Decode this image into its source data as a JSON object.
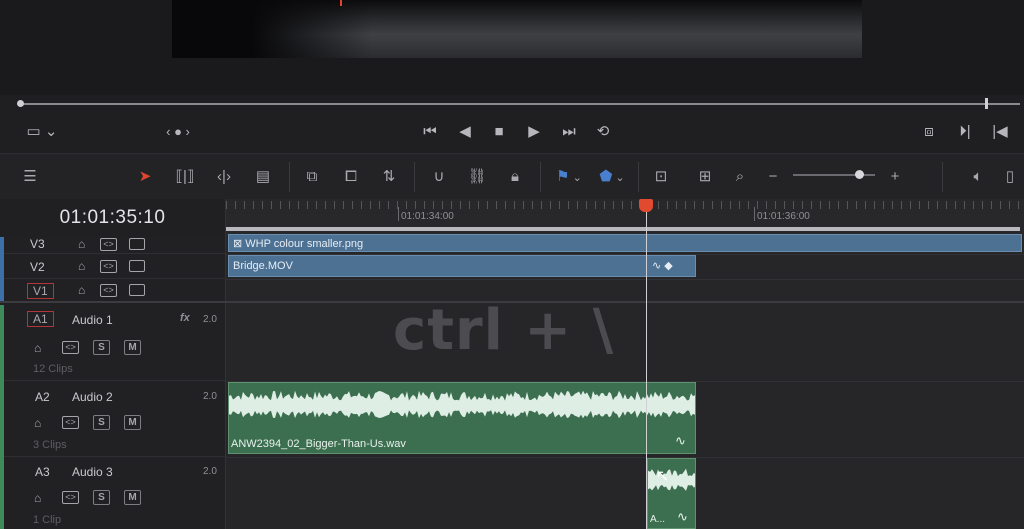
{
  "timeline": {
    "timecode": "01:01:35:10",
    "ruler_labels": [
      "01:01:34:00",
      "01:01:36:00"
    ]
  },
  "overlay_shortcut": "ctrl + \\",
  "tracks": {
    "video": [
      {
        "id": "V3",
        "clip": "WHP colour smaller.png"
      },
      {
        "id": "V2",
        "clip": "Bridge.MOV"
      },
      {
        "id": "V1"
      }
    ],
    "audio": [
      {
        "id": "A1",
        "name": "Audio 1",
        "fx": "fx",
        "volume": "2.0",
        "clips": "12 Clips"
      },
      {
        "id": "A2",
        "name": "Audio 2",
        "volume": "2.0",
        "clips": "3 Clips",
        "clip": "ANW2394_02_Bigger-Than-Us.wav"
      },
      {
        "id": "A3",
        "name": "Audio 3",
        "volume": "2.0",
        "clips": "1 Clip",
        "clip": "A..."
      }
    ],
    "buttons": {
      "solo": "S",
      "mute": "M"
    }
  },
  "icons": {
    "viewer_size": "viewer-size-icon",
    "nav": "clip-nav-icon",
    "jump_start": "jump-to-start-icon",
    "prev_frame": "reverse-play-icon",
    "stop": "stop-icon",
    "play": "play-icon",
    "jump_end": "jump-to-end-icon",
    "loop": "loop-icon"
  },
  "colors": {
    "playhead": "#e14a2f",
    "video_clip": "#4d7193",
    "audio_clip": "#3c6e50",
    "selection_tool": "#e0442e",
    "flag": "#4a7fd0"
  }
}
